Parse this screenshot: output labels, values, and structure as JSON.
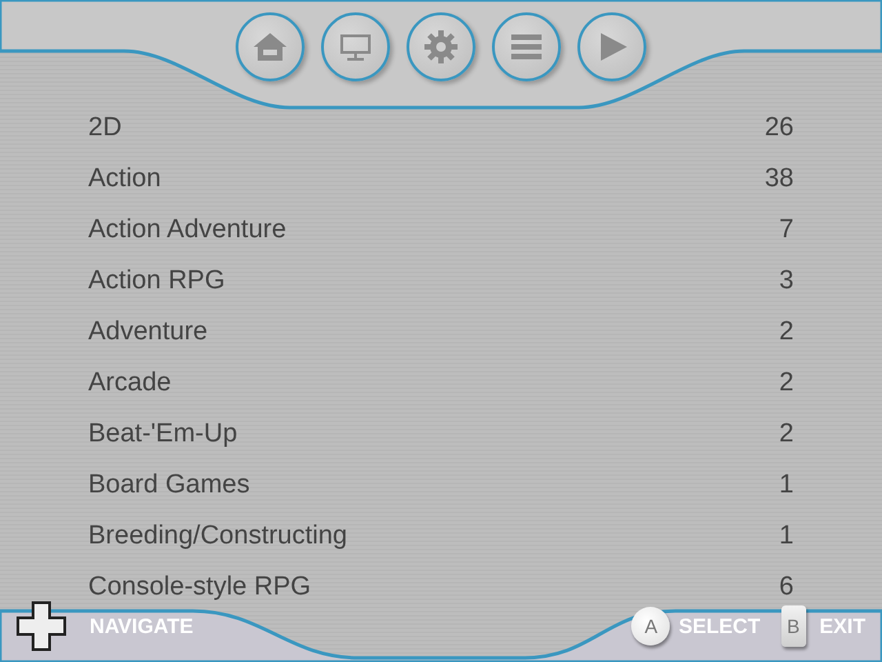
{
  "toolbar": [
    {
      "kind": "home"
    },
    {
      "kind": "display"
    },
    {
      "kind": "settings"
    },
    {
      "kind": "list"
    },
    {
      "kind": "play"
    }
  ],
  "genres": [
    {
      "name": "2D",
      "count": "26"
    },
    {
      "name": "Action",
      "count": "38"
    },
    {
      "name": "Action Adventure",
      "count": "7"
    },
    {
      "name": "Action RPG",
      "count": "3"
    },
    {
      "name": "Adventure",
      "count": "2"
    },
    {
      "name": "Arcade",
      "count": "2"
    },
    {
      "name": "Beat-'Em-Up",
      "count": "2"
    },
    {
      "name": "Board Games",
      "count": "1"
    },
    {
      "name": "Breeding/Constructing",
      "count": "1"
    },
    {
      "name": "Console-style RPG",
      "count": "6"
    }
  ],
  "footer": {
    "navigate": "NAVIGATE",
    "select_key": "A",
    "select": "SELECT",
    "exit_key": "B",
    "exit": "EXIT"
  }
}
